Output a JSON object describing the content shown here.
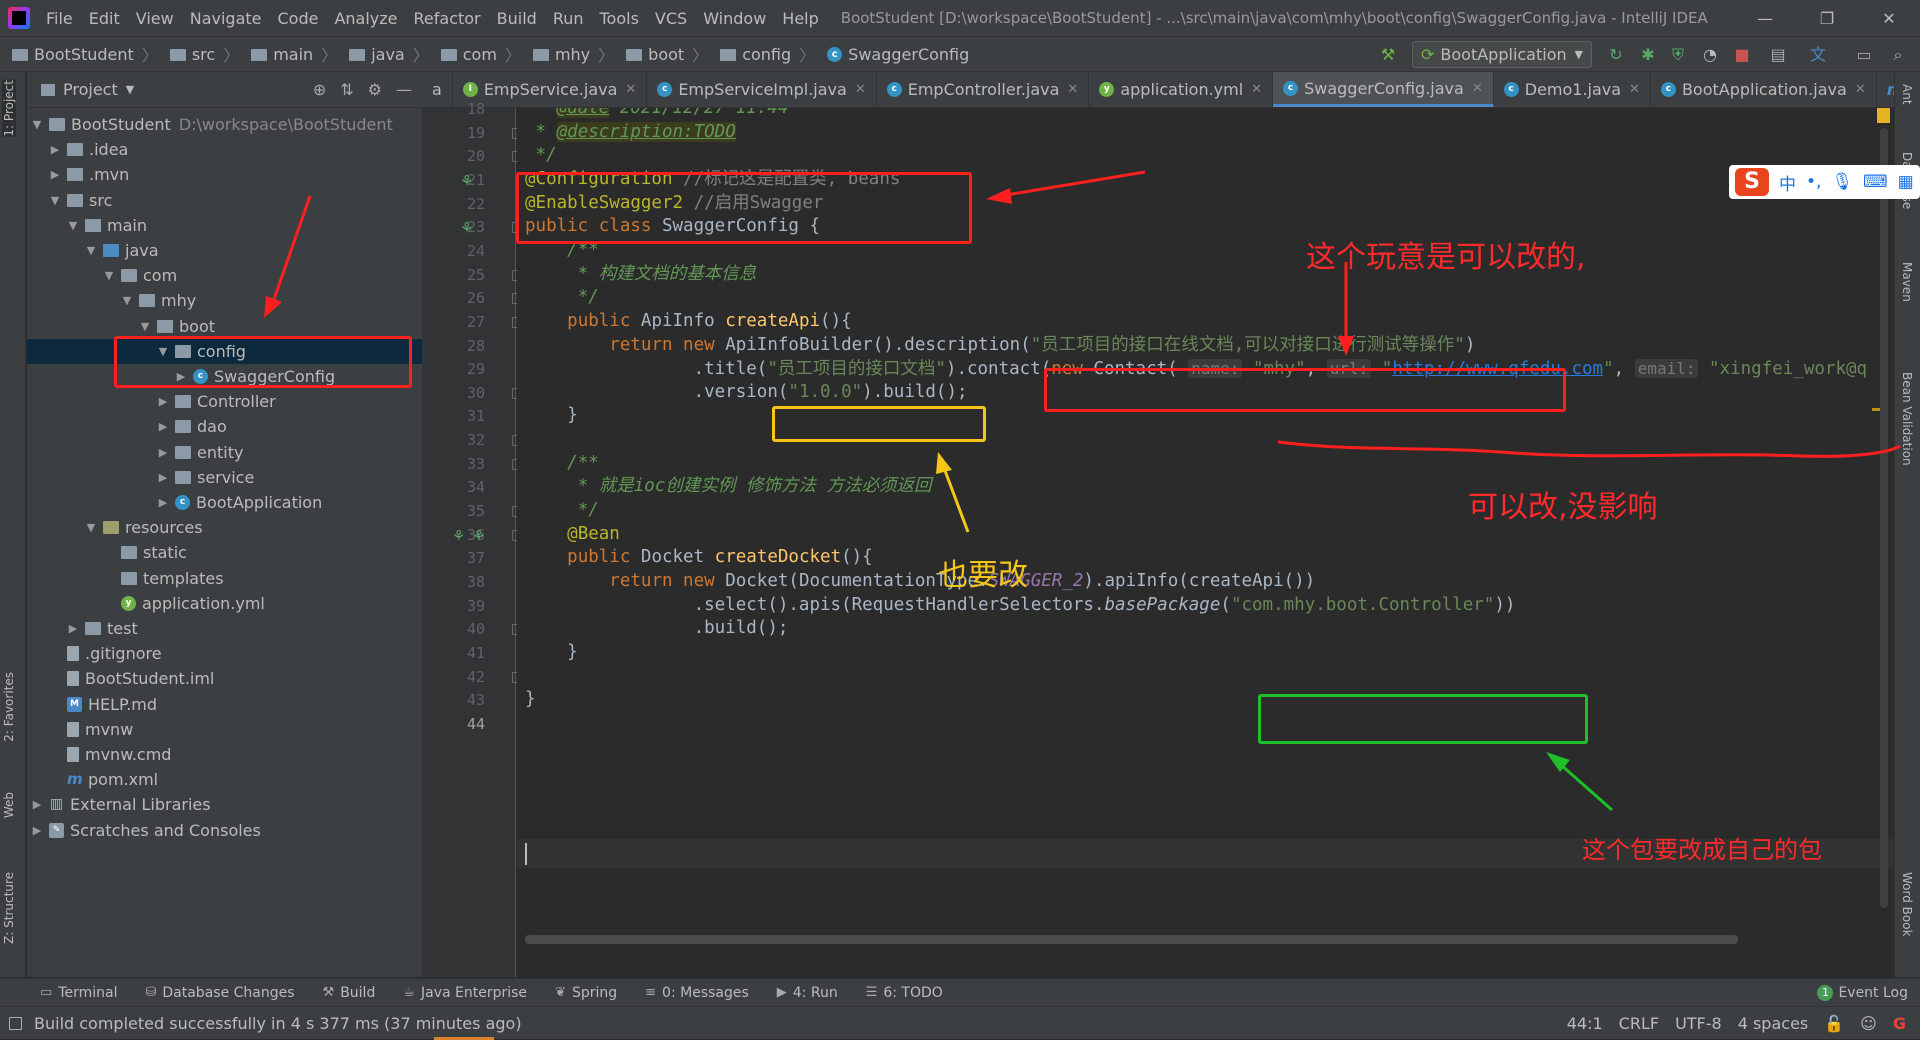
{
  "menubar": {
    "items": [
      "File",
      "Edit",
      "View",
      "Navigate",
      "Code",
      "Analyze",
      "Refactor",
      "Build",
      "Run",
      "Tools",
      "VCS",
      "Window",
      "Help"
    ],
    "window_title": "BootStudent [D:\\workspace\\BootStudent] - ...\\src\\main\\java\\com\\mhy\\boot\\config\\SwaggerConfig.java - IntelliJ IDEA"
  },
  "breadcrumb": [
    "BootStudent",
    "src",
    "main",
    "java",
    "com",
    "mhy",
    "boot",
    "config",
    "SwaggerConfig"
  ],
  "run_config": "BootApplication",
  "project": {
    "header": "Project",
    "tree": [
      {
        "label": "BootStudent",
        "path": "D:\\workspace\\BootStudent",
        "depth": 0,
        "open": true,
        "icon": "folder"
      },
      {
        "label": ".idea",
        "depth": 1,
        "open": false,
        "icon": "folder"
      },
      {
        "label": ".mvn",
        "depth": 1,
        "open": false,
        "icon": "folder"
      },
      {
        "label": "src",
        "depth": 1,
        "open": true,
        "icon": "folder"
      },
      {
        "label": "main",
        "depth": 2,
        "open": true,
        "icon": "folder"
      },
      {
        "label": "java",
        "depth": 3,
        "open": true,
        "icon": "src"
      },
      {
        "label": "com",
        "depth": 4,
        "open": true,
        "icon": "pkg"
      },
      {
        "label": "mhy",
        "depth": 5,
        "open": true,
        "icon": "pkg"
      },
      {
        "label": "boot",
        "depth": 6,
        "open": true,
        "icon": "pkg"
      },
      {
        "label": "config",
        "depth": 7,
        "open": true,
        "icon": "pkg",
        "selected": true
      },
      {
        "label": "SwaggerConfig",
        "depth": 8,
        "open": false,
        "icon": "class"
      },
      {
        "label": "Controller",
        "depth": 7,
        "open": false,
        "icon": "pkg"
      },
      {
        "label": "dao",
        "depth": 7,
        "open": false,
        "icon": "pkg"
      },
      {
        "label": "entity",
        "depth": 7,
        "open": false,
        "icon": "pkg"
      },
      {
        "label": "service",
        "depth": 7,
        "open": false,
        "icon": "pkg"
      },
      {
        "label": "BootApplication",
        "depth": 7,
        "open": false,
        "icon": "springclass"
      },
      {
        "label": "resources",
        "depth": 3,
        "open": true,
        "icon": "res"
      },
      {
        "label": "static",
        "depth": 4,
        "icon": "folder",
        "leaf": true
      },
      {
        "label": "templates",
        "depth": 4,
        "icon": "folder",
        "leaf": true
      },
      {
        "label": "application.yml",
        "depth": 4,
        "icon": "yml",
        "leaf": true
      },
      {
        "label": "test",
        "depth": 2,
        "open": false,
        "icon": "folder"
      },
      {
        "label": ".gitignore",
        "depth": 1,
        "icon": "file",
        "leaf": true
      },
      {
        "label": "BootStudent.iml",
        "depth": 1,
        "icon": "file",
        "leaf": true
      },
      {
        "label": "HELP.md",
        "depth": 1,
        "icon": "md",
        "leaf": true
      },
      {
        "label": "mvnw",
        "depth": 1,
        "icon": "file",
        "leaf": true
      },
      {
        "label": "mvnw.cmd",
        "depth": 1,
        "icon": "file",
        "leaf": true
      },
      {
        "label": "pom.xml",
        "depth": 1,
        "icon": "maven",
        "leaf": true
      },
      {
        "label": "External Libraries",
        "depth": 0,
        "open": false,
        "icon": "lib"
      },
      {
        "label": "Scratches and Consoles",
        "depth": 0,
        "open": false,
        "icon": "scratch"
      }
    ]
  },
  "tabs": [
    {
      "label": "a",
      "icon": "none"
    },
    {
      "label": "EmpService.java",
      "icon": "interface"
    },
    {
      "label": "EmpServiceImpl.java",
      "icon": "class"
    },
    {
      "label": "EmpController.java",
      "icon": "class"
    },
    {
      "label": "application.yml",
      "icon": "yml"
    },
    {
      "label": "SwaggerConfig.java",
      "icon": "class",
      "active": true
    },
    {
      "label": "Demo1.java",
      "icon": "class"
    },
    {
      "label": "BootApplication.java",
      "icon": "springclass"
    },
    {
      "label": "p",
      "icon": "maven"
    }
  ],
  "editor": {
    "line_numbers": [
      18,
      19,
      20,
      21,
      22,
      23,
      24,
      25,
      26,
      27,
      28,
      29,
      30,
      31,
      32,
      33,
      34,
      35,
      36,
      37,
      38,
      39,
      40,
      41,
      42,
      43,
      44
    ],
    "current_line": 44
  },
  "left_strip_tabs": [
    "1: Project",
    "2: Favorites",
    "Web",
    "Z: Structure"
  ],
  "right_strip_tabs": [
    "Ant",
    "Database",
    "Maven",
    "Bean Validation",
    "Word Book"
  ],
  "tool_tabs": [
    {
      "label": "Terminal",
      "icon": "terminal-icon"
    },
    {
      "label": "Database Changes",
      "icon": "database-icon"
    },
    {
      "label": "Build",
      "icon": "hammer-icon"
    },
    {
      "label": "Java Enterprise",
      "icon": "java-ee-icon"
    },
    {
      "label": "Spring",
      "icon": "spring-icon"
    },
    {
      "label": "0: Messages",
      "icon": "messages-icon"
    },
    {
      "label": "4: Run",
      "icon": "run-icon"
    },
    {
      "label": "6: TODO",
      "icon": "todo-icon"
    }
  ],
  "event_log": {
    "label": "Event Log",
    "count": "1"
  },
  "status": {
    "message": "Build completed successfully in 4 s 377 ms (37 minutes ago)",
    "position": "44:1",
    "line_sep": "CRLF",
    "encoding": "UTF-8",
    "indent": "4 spaces"
  },
  "ime": {
    "logo": "S",
    "mode": "中"
  },
  "annotations": {
    "changeable": "这个玩意是可以改的,",
    "no_effect": "可以改,没影响",
    "also_change": "也要改",
    "change_package": "这个包要改成自己的包"
  },
  "colors": {
    "annotation_red": "#ff1f1f",
    "annotation_yellow": "#f5c518",
    "annotation_green": "#1fbf2a"
  }
}
